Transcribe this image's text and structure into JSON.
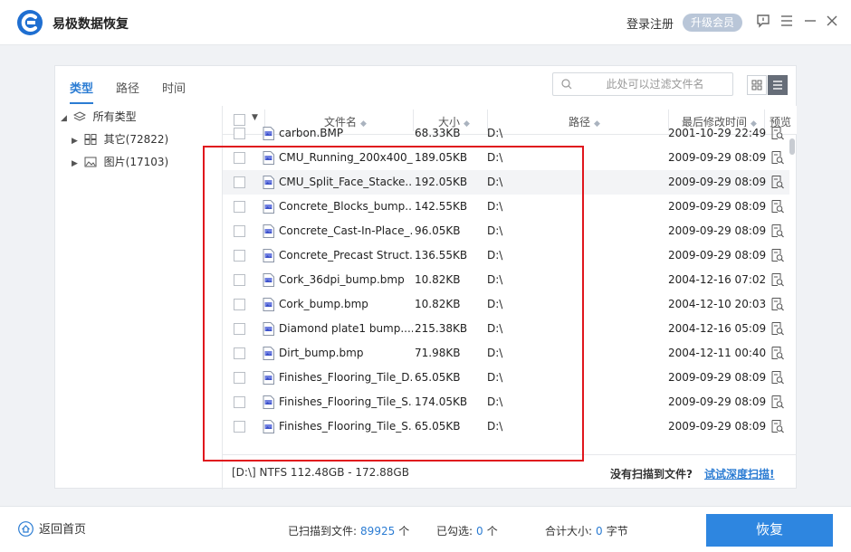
{
  "app": {
    "title": "易极数据恢复",
    "login": "登录注册",
    "vip": "升级会员"
  },
  "tabs": [
    {
      "label": "类型"
    },
    {
      "label": "路径"
    },
    {
      "label": "时间"
    }
  ],
  "search": {
    "placeholder": "此处可以过滤文件名"
  },
  "tree": {
    "root": "所有类型",
    "children": [
      {
        "label": "其它(72822)"
      },
      {
        "label": "图片(17103)"
      }
    ]
  },
  "columns": {
    "name": "文件名",
    "size": "大小",
    "path": "路径",
    "modified": "最后修改时间",
    "preview": "预览"
  },
  "files": [
    {
      "name": "carbon.BMP",
      "size": "68.33KB",
      "path": "D:\\",
      "modified": "2001-10-29 22:49"
    },
    {
      "name": "CMU_Running_200x400_...",
      "size": "189.05KB",
      "path": "D:\\",
      "modified": "2009-09-29 08:09"
    },
    {
      "name": "CMU_Split_Face_Stacke...",
      "size": "192.05KB",
      "path": "D:\\",
      "modified": "2009-09-29 08:09"
    },
    {
      "name": "Concrete_Blocks_bump....",
      "size": "142.55KB",
      "path": "D:\\",
      "modified": "2009-09-29 08:09"
    },
    {
      "name": "Concrete_Cast-In-Place_...",
      "size": "96.05KB",
      "path": "D:\\",
      "modified": "2009-09-29 08:09"
    },
    {
      "name": "Concrete_Precast Struct...",
      "size": "136.55KB",
      "path": "D:\\",
      "modified": "2009-09-29 08:09"
    },
    {
      "name": "Cork_36dpi_bump.bmp",
      "size": "10.82KB",
      "path": "D:\\",
      "modified": "2004-12-16 07:02"
    },
    {
      "name": "Cork_bump.bmp",
      "size": "10.82KB",
      "path": "D:\\",
      "modified": "2004-12-10 20:03"
    },
    {
      "name": "Diamond plate1 bump....",
      "size": "215.38KB",
      "path": "D:\\",
      "modified": "2004-12-16 05:09"
    },
    {
      "name": "Dirt_bump.bmp",
      "size": "71.98KB",
      "path": "D:\\",
      "modified": "2004-12-11 00:40"
    },
    {
      "name": "Finishes_Flooring_Tile_D...",
      "size": "65.05KB",
      "path": "D:\\",
      "modified": "2009-09-29 08:09"
    },
    {
      "name": "Finishes_Flooring_Tile_S...",
      "size": "174.05KB",
      "path": "D:\\",
      "modified": "2009-09-29 08:09"
    },
    {
      "name": "Finishes_Flooring_Tile_S...",
      "size": "65.05KB",
      "path": "D:\\",
      "modified": "2009-09-29 08:09"
    }
  ],
  "footer": {
    "disk_info": "[D:\\] NTFS 112.48GB - 172.88GB",
    "no_scan": "没有扫描到文件?",
    "deep_scan": "试试深度扫描!"
  },
  "bottom": {
    "home": "返回首页",
    "scanned_label": "已扫描到文件:",
    "scanned_count": "89925",
    "scanned_unit": "个",
    "selected_label": "已勾选:",
    "selected_count": "0",
    "selected_unit": "个",
    "total_label": "合计大小:",
    "total_size": "0",
    "total_unit": "字节",
    "recover": "恢复"
  },
  "colors": {
    "accent": "#2b7cd3",
    "highlight_box": "#e0161d"
  }
}
